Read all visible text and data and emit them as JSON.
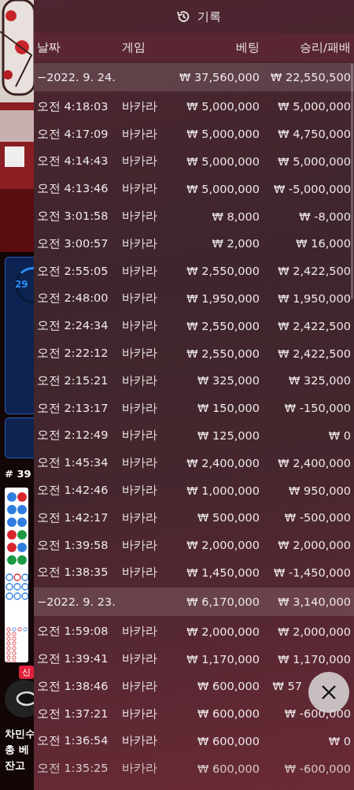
{
  "background_app": {
    "progress": "29",
    "round": "# 39",
    "badge": "신",
    "player": "차민수",
    "total_bet_label": "총 베",
    "balance_label": "잔고"
  },
  "history": {
    "title": "기록",
    "columns": [
      "날짜",
      "게임",
      "베팅",
      "승리/패배"
    ],
    "days": [
      {
        "date": "−2022. 9. 24.",
        "bet": "₩ 37,560,000",
        "result": "₩ 22,550,500",
        "rows": [
          {
            "time": "오전 4:18:03",
            "game": "바카라",
            "bet": "₩ 5,000,000",
            "result": "₩ 5,000,000"
          },
          {
            "time": "오전 4:17:09",
            "game": "바카라",
            "bet": "₩ 5,000,000",
            "result": "₩ 4,750,000"
          },
          {
            "time": "오전 4:14:43",
            "game": "바카라",
            "bet": "₩ 5,000,000",
            "result": "₩ 5,000,000"
          },
          {
            "time": "오전 4:13:46",
            "game": "바카라",
            "bet": "₩ 5,000,000",
            "result": "₩ -5,000,000"
          },
          {
            "time": "오전 3:01:58",
            "game": "바카라",
            "bet": "₩ 8,000",
            "result": "₩ -8,000"
          },
          {
            "time": "오전 3:00:57",
            "game": "바카라",
            "bet": "₩ 2,000",
            "result": "₩ 16,000"
          },
          {
            "time": "오전 2:55:05",
            "game": "바카라",
            "bet": "₩ 2,550,000",
            "result": "₩ 2,422,500"
          },
          {
            "time": "오전 2:48:00",
            "game": "바카라",
            "bet": "₩ 1,950,000",
            "result": "₩ 1,950,000"
          },
          {
            "time": "오전 2:24:34",
            "game": "바카라",
            "bet": "₩ 2,550,000",
            "result": "₩ 2,422,500"
          },
          {
            "time": "오전 2:22:12",
            "game": "바카라",
            "bet": "₩ 2,550,000",
            "result": "₩ 2,422,500"
          },
          {
            "time": "오전 2:15:21",
            "game": "바카라",
            "bet": "₩ 325,000",
            "result": "₩ 325,000"
          },
          {
            "time": "오전 2:13:17",
            "game": "바카라",
            "bet": "₩ 150,000",
            "result": "₩ -150,000"
          },
          {
            "time": "오전 2:12:49",
            "game": "바카라",
            "bet": "₩ 125,000",
            "result": "₩ 0"
          },
          {
            "time": "오전 1:45:34",
            "game": "바카라",
            "bet": "₩ 2,400,000",
            "result": "₩ 2,400,000"
          },
          {
            "time": "오전 1:42:46",
            "game": "바카라",
            "bet": "₩ 1,000,000",
            "result": "₩ 950,000"
          },
          {
            "time": "오전 1:42:17",
            "game": "바카라",
            "bet": "₩ 500,000",
            "result": "₩ -500,000"
          },
          {
            "time": "오전 1:39:58",
            "game": "바카라",
            "bet": "₩ 2,000,000",
            "result": "₩ 2,000,000"
          },
          {
            "time": "오전 1:38:35",
            "game": "바카라",
            "bet": "₩ 1,450,000",
            "result": "₩ -1,450,000"
          }
        ]
      },
      {
        "date": "−2022. 9. 23.",
        "bet": "₩ 6,170,000",
        "result": "₩ 3,140,000",
        "rows": [
          {
            "time": "오전 1:59:08",
            "game": "바카라",
            "bet": "₩ 2,000,000",
            "result": "₩ 2,000,000"
          },
          {
            "time": "오전 1:39:41",
            "game": "바카라",
            "bet": "₩ 1,170,000",
            "result": "₩ 1,170,000"
          },
          {
            "time": "오전 1:38:46",
            "game": "바카라",
            "bet": "₩ 600,000",
            "result": "₩ 57",
            "covered_by_close_button": true
          },
          {
            "time": "오전 1:37:21",
            "game": "바카라",
            "bet": "₩ 600,000",
            "result": "₩ -600,000"
          },
          {
            "time": "오전 1:36:54",
            "game": "바카라",
            "bet": "₩ 600,000",
            "result": "₩ 0"
          },
          {
            "time": "오전 1:35:25",
            "game": "바카라",
            "bet": "₩ 600,000",
            "result": "₩ -600,000"
          }
        ]
      }
    ]
  }
}
